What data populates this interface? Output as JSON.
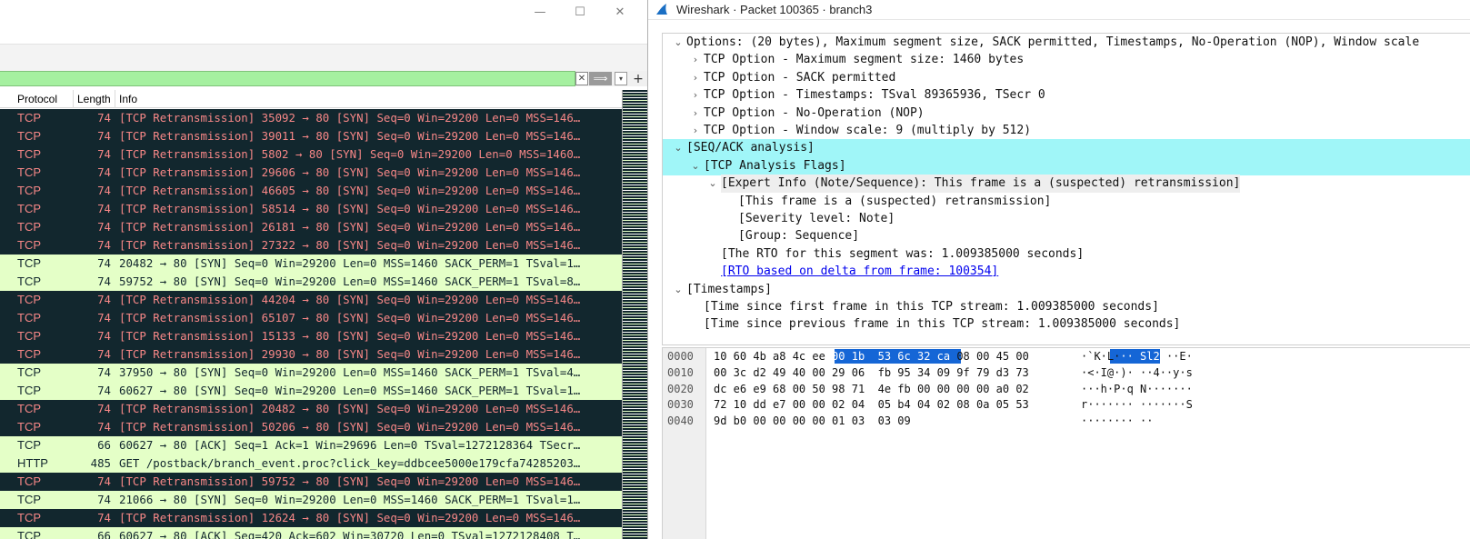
{
  "left_window": {
    "controls": {
      "minimize": "—",
      "maximize": "☐",
      "close": "✕"
    },
    "filter": {
      "value": "",
      "clear_icon": "✕",
      "apply_icon": "⟹",
      "dropdown_icon": "▾",
      "add_icon": "+"
    },
    "columns": {
      "protocol": "Protocol",
      "length": "Length",
      "info": "Info"
    },
    "rows": [
      {
        "proto": "TCP",
        "len": "74",
        "info": "[TCP Retransmission] 35092 → 80 [SYN] Seq=0 Win=29200 Len=0 MSS=146…",
        "kind": "retx"
      },
      {
        "proto": "TCP",
        "len": "74",
        "info": "[TCP Retransmission] 39011 → 80 [SYN] Seq=0 Win=29200 Len=0 MSS=146…",
        "kind": "retx"
      },
      {
        "proto": "TCP",
        "len": "74",
        "info": "[TCP Retransmission] 5802 → 80 [SYN] Seq=0 Win=29200 Len=0 MSS=1460…",
        "kind": "retx"
      },
      {
        "proto": "TCP",
        "len": "74",
        "info": "[TCP Retransmission] 29606 → 80 [SYN] Seq=0 Win=29200 Len=0 MSS=146…",
        "kind": "retx"
      },
      {
        "proto": "TCP",
        "len": "74",
        "info": "[TCP Retransmission] 46605 → 80 [SYN] Seq=0 Win=29200 Len=0 MSS=146…",
        "kind": "retx"
      },
      {
        "proto": "TCP",
        "len": "74",
        "info": "[TCP Retransmission] 58514 → 80 [SYN] Seq=0 Win=29200 Len=0 MSS=146…",
        "kind": "retx"
      },
      {
        "proto": "TCP",
        "len": "74",
        "info": "[TCP Retransmission] 26181 → 80 [SYN] Seq=0 Win=29200 Len=0 MSS=146…",
        "kind": "retx"
      },
      {
        "proto": "TCP",
        "len": "74",
        "info": "[TCP Retransmission] 27322 → 80 [SYN] Seq=0 Win=29200 Len=0 MSS=146…",
        "kind": "retx"
      },
      {
        "proto": "TCP",
        "len": "74",
        "info": "20482 → 80 [SYN] Seq=0 Win=29200 Len=0 MSS=1460 SACK_PERM=1 TSval=1…",
        "kind": "ok"
      },
      {
        "proto": "TCP",
        "len": "74",
        "info": "59752 → 80 [SYN] Seq=0 Win=29200 Len=0 MSS=1460 SACK_PERM=1 TSval=8…",
        "kind": "ok"
      },
      {
        "proto": "TCP",
        "len": "74",
        "info": "[TCP Retransmission] 44204 → 80 [SYN] Seq=0 Win=29200 Len=0 MSS=146…",
        "kind": "retx"
      },
      {
        "proto": "TCP",
        "len": "74",
        "info": "[TCP Retransmission] 65107 → 80 [SYN] Seq=0 Win=29200 Len=0 MSS=146…",
        "kind": "retx"
      },
      {
        "proto": "TCP",
        "len": "74",
        "info": "[TCP Retransmission] 15133 → 80 [SYN] Seq=0 Win=29200 Len=0 MSS=146…",
        "kind": "retx"
      },
      {
        "proto": "TCP",
        "len": "74",
        "info": "[TCP Retransmission] 29930 → 80 [SYN] Seq=0 Win=29200 Len=0 MSS=146…",
        "kind": "retx"
      },
      {
        "proto": "TCP",
        "len": "74",
        "info": "37950 → 80 [SYN] Seq=0 Win=29200 Len=0 MSS=1460 SACK_PERM=1 TSval=4…",
        "kind": "ok"
      },
      {
        "proto": "TCP",
        "len": "74",
        "info": "60627 → 80 [SYN] Seq=0 Win=29200 Len=0 MSS=1460 SACK_PERM=1 TSval=1…",
        "kind": "ok"
      },
      {
        "proto": "TCP",
        "len": "74",
        "info": "[TCP Retransmission] 20482 → 80 [SYN] Seq=0 Win=29200 Len=0 MSS=146…",
        "kind": "retx"
      },
      {
        "proto": "TCP",
        "len": "74",
        "info": "[TCP Retransmission] 50206 → 80 [SYN] Seq=0 Win=29200 Len=0 MSS=146…",
        "kind": "retx"
      },
      {
        "proto": "TCP",
        "len": "66",
        "info": "60627 → 80 [ACK] Seq=1 Ack=1 Win=29696 Len=0 TSval=1272128364 TSecr…",
        "kind": "ok"
      },
      {
        "proto": "HTTP",
        "len": "485",
        "info": "GET /postback/branch_event.proc?click_key=ddbcee5000e179cfa74285203…",
        "kind": "ok"
      },
      {
        "proto": "TCP",
        "len": "74",
        "info": "[TCP Retransmission] 59752 → 80 [SYN] Seq=0 Win=29200 Len=0 MSS=146…",
        "kind": "retx"
      },
      {
        "proto": "TCP",
        "len": "74",
        "info": "21066 → 80 [SYN] Seq=0 Win=29200 Len=0 MSS=1460 SACK_PERM=1 TSval=1…",
        "kind": "ok"
      },
      {
        "proto": "TCP",
        "len": "74",
        "info": "[TCP Retransmission] 12624 → 80 [SYN] Seq=0 Win=29200 Len=0 MSS=146…",
        "kind": "retx"
      },
      {
        "proto": "TCP",
        "len": "66",
        "info": "60627 → 80 [ACK] Seq=420 Ack=602 Win=30720 Len=0 TSval=1272128408 T…",
        "kind": "ok"
      }
    ]
  },
  "right_window": {
    "title": "Wireshark · Packet 100365 · branch3",
    "tree": [
      {
        "text": "Options: (20 bytes), Maximum segment size, SACK permitted, Timestamps, No-Operation (NOP), Window scale",
        "depth": 0,
        "arrow": "⌄",
        "style": ""
      },
      {
        "text": "TCP Option - Maximum segment size: 1460 bytes",
        "depth": 1,
        "arrow": "›",
        "style": ""
      },
      {
        "text": "TCP Option - SACK permitted",
        "depth": 1,
        "arrow": "›",
        "style": ""
      },
      {
        "text": "TCP Option - Timestamps: TSval 89365936, TSecr 0",
        "depth": 1,
        "arrow": "›",
        "style": ""
      },
      {
        "text": "TCP Option - No-Operation (NOP)",
        "depth": 1,
        "arrow": "›",
        "style": ""
      },
      {
        "text": "TCP Option - Window scale: 9 (multiply by 512)",
        "depth": 1,
        "arrow": "›",
        "style": ""
      },
      {
        "text": "[SEQ/ACK analysis]",
        "depth": 0,
        "arrow": "⌄",
        "style": "hl-cyan"
      },
      {
        "text": "[TCP Analysis Flags]",
        "depth": 1,
        "arrow": "⌄",
        "style": "hl-cyan"
      },
      {
        "text": "[Expert Info (Note/Sequence): This frame is a (suspected) retransmission]",
        "depth": 2,
        "arrow": "⌄",
        "style": "hl-grey"
      },
      {
        "text": "[This frame is a (suspected) retransmission]",
        "depth": 3,
        "arrow": "",
        "style": ""
      },
      {
        "text": "[Severity level: Note]",
        "depth": 3,
        "arrow": "",
        "style": ""
      },
      {
        "text": "[Group: Sequence]",
        "depth": 3,
        "arrow": "",
        "style": ""
      },
      {
        "text": "[The RTO for this segment was: 1.009385000 seconds]",
        "depth": 2,
        "arrow": "",
        "style": ""
      },
      {
        "text": "[RTO based on delta from frame: 100354]",
        "depth": 2,
        "arrow": "",
        "style": "link"
      },
      {
        "text": "[Timestamps]",
        "depth": 0,
        "arrow": "⌄",
        "style": ""
      },
      {
        "text": "[Time since first frame in this TCP stream: 1.009385000 seconds]",
        "depth": 1,
        "arrow": "",
        "style": ""
      },
      {
        "text": "[Time since previous frame in this TCP stream: 1.009385000 seconds]",
        "depth": 1,
        "arrow": "",
        "style": ""
      }
    ],
    "bytes": [
      {
        "off": "0000",
        "hex": "10 60 4b a8 4c ee 00 1b  53 6c 32 ca 08 00 45 00",
        "asc": "·`K·L··· Sl2···E·"
      },
      {
        "off": "0010",
        "hex": "00 3c d2 49 40 00 29 06  fb 95 34 09 9f 79 d3 73",
        "asc": "·<·I@·)· ··4··y·s"
      },
      {
        "off": "0020",
        "hex": "dc e6 e9 68 00 50 98 71  4e fb 00 00 00 00 a0 02",
        "asc": "···h·P·q N·······"
      },
      {
        "off": "0030",
        "hex": "72 10 dd e7 00 00 02 04  05 b4 04 02 08 0a 05 53",
        "asc": "r······· ·······S"
      },
      {
        "off": "0040",
        "hex": "9d b0 00 00 00 00 01 03  03 09",
        "asc": "········ ··"
      }
    ],
    "colors": {
      "selection": "#1566d6",
      "tree_highlight": "#a0f6f8",
      "retx_bg": "#12272e",
      "retx_fg": "#f78787",
      "ok_bg": "#e4ffc7"
    }
  }
}
